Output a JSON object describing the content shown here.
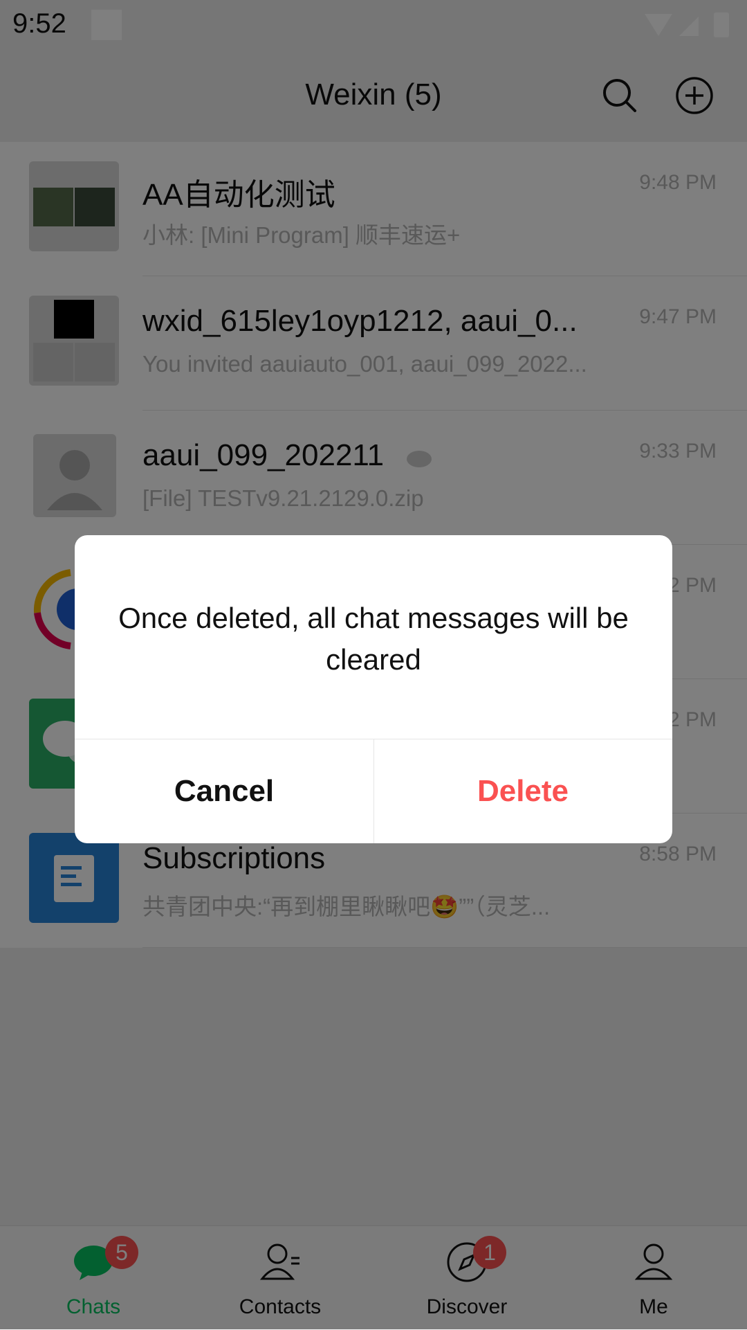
{
  "status": {
    "time": "9:52"
  },
  "nav": {
    "title": "Weixin (5)"
  },
  "chats": [
    {
      "title": "AA自动化测试",
      "preview": "小林: [Mini Program] 顺丰速运+",
      "time": "9:48 PM"
    },
    {
      "title": "wxid_615ley1oyp1212, aaui_0...",
      "preview": "You invited aauiauto_001, aaui_099_2022...",
      "time": "9:47 PM"
    },
    {
      "title": "aaui_099_202211",
      "preview": "[File]  TESTv9.21.2129.0.zip",
      "time": "9:33 PM"
    },
    {
      "title": "",
      "preview": "",
      "time": "2 PM"
    },
    {
      "title": "",
      "preview": "",
      "time": "2 PM"
    },
    {
      "title": "Subscriptions",
      "preview": "共青团中央:“再到棚里瞅瞅吧🤩””（灵芝...",
      "time": "8:58 PM"
    }
  ],
  "tabs": [
    {
      "label": "Chats",
      "badge": "5",
      "color": "#07c160"
    },
    {
      "label": "Contacts",
      "badge": ""
    },
    {
      "label": "Discover",
      "badge": "1"
    },
    {
      "label": "Me",
      "badge": ""
    }
  ],
  "dialog": {
    "message": "Once deleted, all chat messages will be cleared",
    "cancel": "Cancel",
    "delete": "Delete",
    "delete_color": "#fa5151"
  }
}
